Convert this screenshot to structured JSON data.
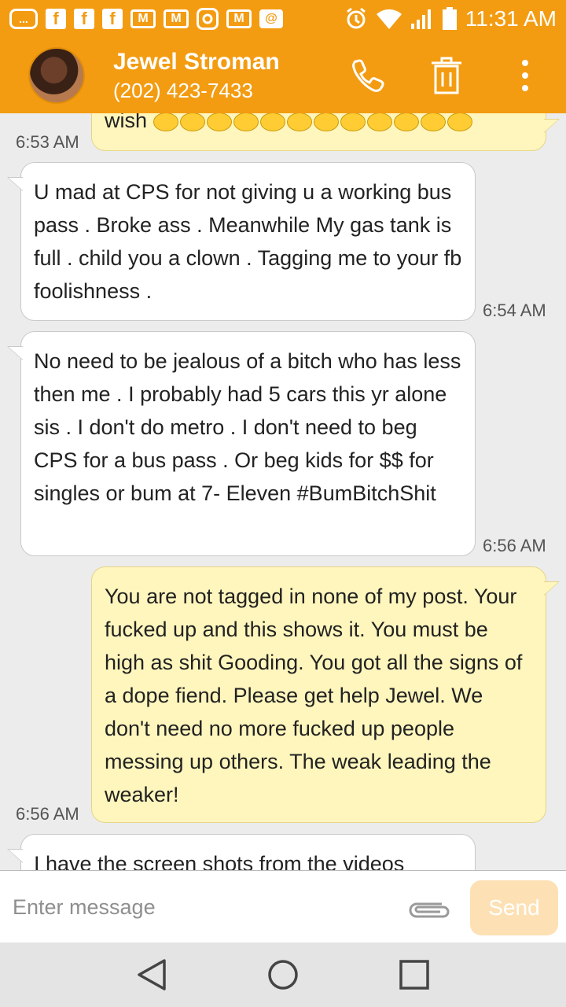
{
  "status_bar": {
    "time": "11:31 AM",
    "icons": [
      "chat-icon",
      "facebook-icon",
      "facebook-icon",
      "facebook-icon",
      "gmail-icon",
      "gmail-icon",
      "instagram-icon",
      "gmail-icon",
      "email-at-icon",
      "alarm-icon",
      "wifi-icon",
      "signal-icon",
      "battery-icon"
    ],
    "fb_letter": "f",
    "mail_letter": "M",
    "at_letter": "@",
    "chat_letter": "..."
  },
  "header": {
    "contact_name": "Jewel Stroman",
    "contact_phone": "(202) 423-7433",
    "actions": [
      "phone-icon",
      "trash-icon",
      "overflow-menu-icon"
    ]
  },
  "messages": [
    {
      "direction": "out",
      "text": "wish",
      "emoji_count": 12,
      "time": "6:53 AM"
    },
    {
      "direction": "in",
      "text": "U mad at CPS for not giving u a working bus pass . Broke ass . Meanwhile My gas tank is full . child you a clown . Tagging me to your fb foolishness .",
      "time": "6:54 AM"
    },
    {
      "direction": "in",
      "text": "No need to be jealous of a bitch who has less then me . I probably had 5 cars this yr alone sis . I don't do metro . I don't need to beg CPS for a bus pass . Or beg kids for $$ for singles or bum at 7- Eleven #BumBitchShit",
      "time": "6:56 AM"
    },
    {
      "direction": "out",
      "text": "You are not tagged in none of my post. Your fucked up and this shows it. You must be high as shit Gooding. You got all the signs of a dope fiend. Please get help Jewel. We don't need no more fucked up people messing up others. The weak leading the weaker!",
      "time": "6:56 AM"
    },
    {
      "direction": "in",
      "text": "I have the screen shots from the videos",
      "time": ""
    }
  ],
  "composer": {
    "placeholder": "Enter message",
    "value": "",
    "send_label": "Send"
  },
  "nav": [
    "back-icon",
    "home-icon",
    "recents-icon"
  ],
  "colors": {
    "accent": "#f39c12",
    "outgoing_bubble": "#fff6bd",
    "incoming_bubble": "#ffffff",
    "send_disabled": "#fde1b4"
  }
}
